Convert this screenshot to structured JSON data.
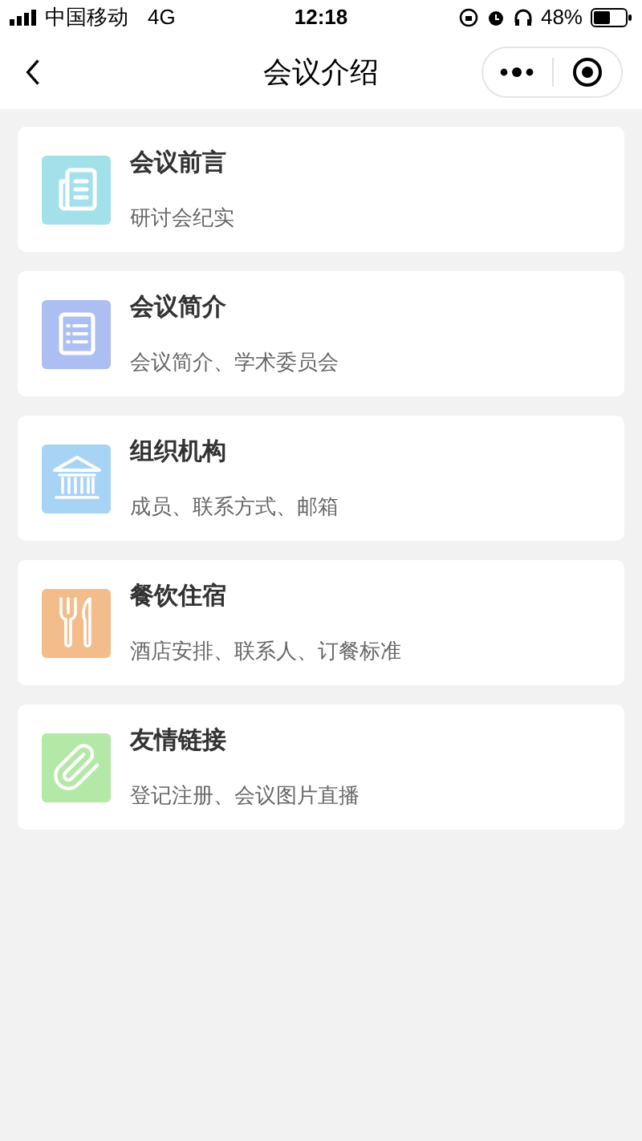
{
  "status_bar": {
    "carrier": "中国移动",
    "network": "4G",
    "time": "12:18",
    "battery": "48%"
  },
  "nav": {
    "title": "会议介绍"
  },
  "items": [
    {
      "title": "会议前言",
      "subtitle": "研讨会纪实",
      "kind": "document",
      "color": "#a3e1ea"
    },
    {
      "title": "会议简介",
      "subtitle": "会议简介、学术委员会",
      "kind": "list",
      "color": "#adbff2"
    },
    {
      "title": "组织机构",
      "subtitle": "成员、联系方式、邮箱",
      "kind": "building",
      "color": "#a7d3f5"
    },
    {
      "title": "餐饮住宿",
      "subtitle": "酒店安排、联系人、订餐标准",
      "kind": "utensils",
      "color": "#f2bc8b"
    },
    {
      "title": "友情链接",
      "subtitle": "登记注册、会议图片直播",
      "kind": "paperclip",
      "color": "#b3e8a6"
    }
  ]
}
